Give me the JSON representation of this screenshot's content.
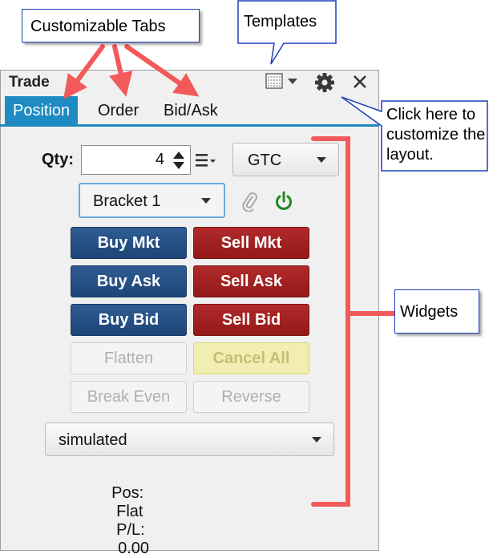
{
  "annotations": {
    "customizable_tabs": "Customizable Tabs",
    "templates": "Templates",
    "customize_help": "Click here to customize the layout.",
    "widgets": "Widgets"
  },
  "panel": {
    "title": "Trade",
    "tabs": [
      "Position",
      "Order",
      "Bid/Ask"
    ],
    "active_tab": "Position"
  },
  "order": {
    "qty_label": "Qty:",
    "qty_value": "4",
    "tif": "GTC",
    "strategy": "Bracket 1"
  },
  "buttons": {
    "buy_mkt": "Buy Mkt",
    "sell_mkt": "Sell Mkt",
    "buy_ask": "Buy Ask",
    "sell_ask": "Sell Ask",
    "buy_bid": "Buy Bid",
    "sell_bid": "Sell Bid",
    "flatten": "Flatten",
    "cancel_all": "Cancel All",
    "break_even": "Break Even",
    "reverse": "Reverse"
  },
  "account": "simulated",
  "status": {
    "pos_label": "Pos:",
    "pos_value": "Flat",
    "pl_label": "P/L:",
    "pl_value": "0.00"
  },
  "colors": {
    "accent": "#1e8bc3",
    "buy": "#244f82",
    "sell": "#a02121",
    "annotation_arrow": "#f25a5a",
    "callout_border": "#1f3fb8",
    "power_icon": "#1e8a1e"
  },
  "icons": [
    "template-icon",
    "settings-gear-icon",
    "close-icon",
    "spin-arrows-icon",
    "list-menu-icon",
    "paperclip-icon",
    "power-icon"
  ]
}
